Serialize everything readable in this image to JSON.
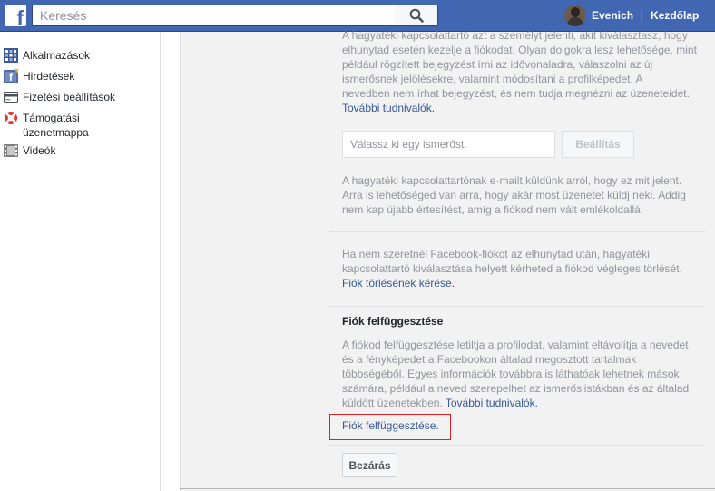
{
  "topbar": {
    "logo_letter": "f",
    "search_placeholder": "Keresés",
    "profile_name": "Evenich",
    "home_label": "Kezdőlap"
  },
  "sidebar": {
    "items": [
      {
        "label": "Alkalmazások",
        "icon": "apps-icon"
      },
      {
        "label": "Hirdetések",
        "icon": "ads-icon"
      },
      {
        "label": "Fizetési beállítások",
        "icon": "payment-card-icon"
      },
      {
        "label": "Támogatási üzenetmappa",
        "icon": "lifebuoy-icon"
      },
      {
        "label": "Videók",
        "icon": "film-icon"
      }
    ]
  },
  "main": {
    "intro_lines": [
      "A hagyatéki kapcsolattartó azt a személyt jelenti, akit kiválasztasz, hogy",
      "elhunytad esetén kezelje a fiókodat. Olyan dolgokra lesz lehetősége, mint",
      "például rögzített bejegyzést írni az idővonaladra, válaszolni az új",
      "ismerősnek jelölésekre, valamint módosítani a profilképedet. A",
      "nevedben nem írhat bejegyzést, és nem tudja megnézni az üzeneteidet."
    ],
    "intro_link": "További tudnivalók.",
    "friend_placeholder": "Válassz ki egy ismerőst.",
    "set_button": "Beállítás",
    "email_lines": [
      "A hagyatéki kapcsolattartónak e-mailt küldünk arról, hogy ez mit jelent.",
      "Arra is lehetőséged van arra, hogy akár most üzenetet küldj neki. Addig",
      "nem kap újabb értesítést, amíg a fiókod nem vált emlékoldallá."
    ],
    "delete_lines": [
      "Ha nem szeretnél Facebook-fiókot az elhunytad után, hagyatéki",
      "kapcsolattartó kiválasztása helyett kérheted a fiókod végleges törlését."
    ],
    "delete_link": "Fiók törlésének kérése.",
    "suspend_title": "Fiók felfüggesztése",
    "suspend_lines": [
      "A fiókod felfüggesztése letiltja a profilodat, valamint eltávolítja a nevedet",
      "és a fényképedet a Facebookon általad megosztott tartalmak",
      "többségéből. Egyes információk továbbra is láthatóak lehetnek mások",
      "számára, például a neved szerepelhet az ismerőslistákban és az általad"
    ],
    "suspend_last_line": "küldött üzenetekben.",
    "suspend_more_link": "További tudnivalók.",
    "suspend_link": "Fiók felfüggesztése.",
    "close_button": "Bezárás"
  }
}
